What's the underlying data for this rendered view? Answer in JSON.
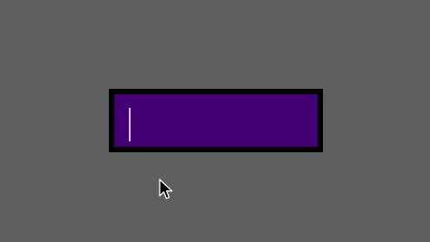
{
  "text_input": {
    "value": ""
  },
  "colors": {
    "background": "#5f5f5f",
    "input_fill": "#430075",
    "input_border": "#000000",
    "caret": "#cfc3df"
  },
  "icons": {
    "cursor": "mouse-pointer-icon"
  }
}
